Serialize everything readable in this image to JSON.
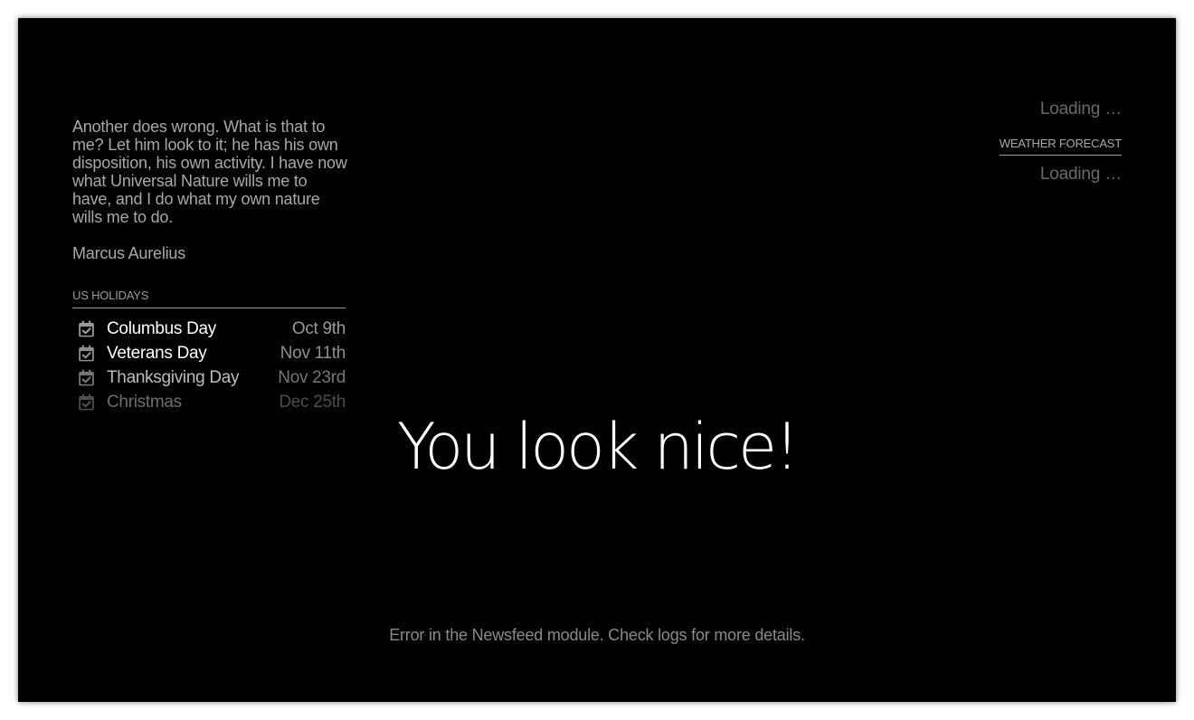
{
  "quote": {
    "text": "Another does wrong. What is that to me? Let him look to it; he has his own disposition, his own activity. I have now what Universal Nature wills me to have, and I do what my own nature wills me to do.",
    "author": "Marcus Aurelius"
  },
  "holidays": {
    "header": "US HOLIDAYS",
    "icon": "calendar-check-icon",
    "items": [
      {
        "name": "Columbus Day",
        "date": "Oct 9th",
        "name_color": "#ffffff",
        "date_color": "#9a9a9a"
      },
      {
        "name": "Veterans Day",
        "date": "Nov 11th",
        "name_color": "#ffffff",
        "date_color": "#8e8e8e"
      },
      {
        "name": "Thanksgiving Day",
        "date": "Nov 23rd",
        "name_color": "#bdbdbd",
        "date_color": "#767676"
      },
      {
        "name": "Christmas",
        "date": "Dec 25th",
        "name_color": "#6d6d6d",
        "date_color": "#4e4e4e"
      }
    ]
  },
  "weather": {
    "current_loading": "Loading …",
    "forecast_header": "WEATHER FORECAST",
    "forecast_loading": "Loading …"
  },
  "compliment": {
    "text": "You look nice!"
  },
  "newsfeed": {
    "error": "Error in the Newsfeed module. Check logs for more details."
  },
  "colors": {
    "background": "#000000",
    "text_bright": "#ffffff",
    "text_dim": "#a8a8a8"
  }
}
